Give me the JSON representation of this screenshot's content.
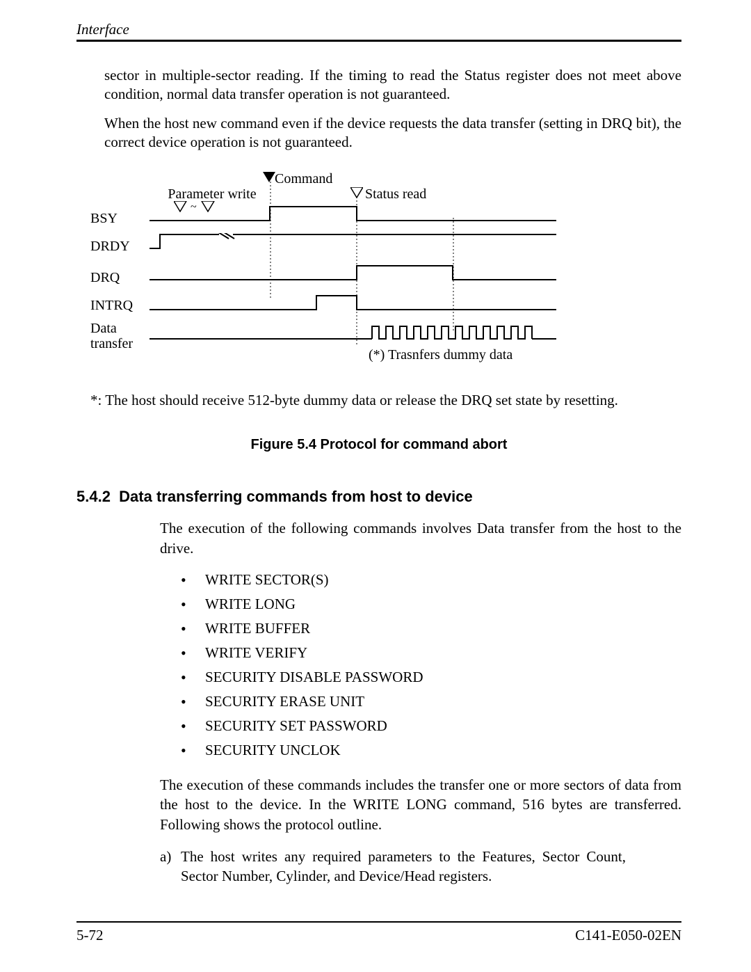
{
  "header": {
    "title": "Interface"
  },
  "intro": {
    "p1": "sector in multiple-sector reading.  If the timing to read the Status register does not meet above condition, normal data transfer operation is not guaranteed.",
    "p2": "When the host new command even if the device requests the data transfer (setting in DRQ bit), the correct device operation is not guaranteed."
  },
  "diagram": {
    "label_param_write": "Parameter write",
    "label_command": "Command",
    "label_status_read": "Status read",
    "sig_bsy": "BSY",
    "sig_drdy": "DRDY",
    "sig_drq": "DRQ",
    "sig_intrq": "INTRQ",
    "sig_data": "Data transfer",
    "note_star": "(*)  Trasnfers dummy data"
  },
  "footnote": "*:  The host should receive 512-byte dummy data or release the DRQ set state by resetting.",
  "figure_caption": "Figure 5.4  Protocol for command abort",
  "section": {
    "number": "5.4.2",
    "title": "Data transferring commands from host to device"
  },
  "body1": "The execution of the following commands involves Data transfer from the host to the drive.",
  "commands": [
    "WRITE SECTOR(S)",
    "WRITE LONG",
    "WRITE BUFFER",
    "WRITE VERIFY",
    "SECURITY DISABLE PASSWORD",
    "SECURITY ERASE UNIT",
    "SECURITY SET PASSWORD",
    "SECURITY UNCLOK"
  ],
  "body2": "The execution of these commands includes the transfer one or more sectors of data from the host to the device.  In the WRITE LONG command, 516 bytes are transferred.  Following shows the protocol outline.",
  "item_a_label": "a)",
  "item_a": "The host writes any required parameters to the Features, Sector Count, Sector Number, Cylinder, and Device/Head registers.",
  "footer": {
    "left": "5-72",
    "right": "C141-E050-02EN"
  }
}
